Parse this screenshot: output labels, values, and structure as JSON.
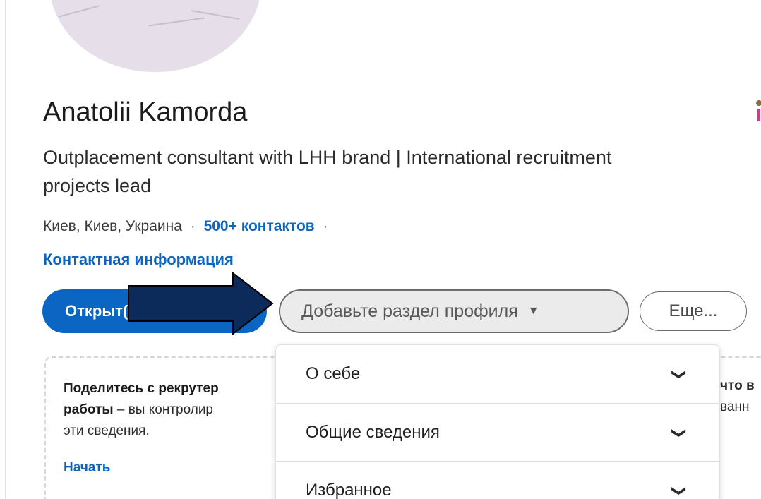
{
  "profile": {
    "name": "Anatolii Kamorda",
    "headline": "Outplacement consultant with LHH brand | International recruitment projects lead",
    "location": "Киев, Киев, Украина",
    "separator": "·",
    "contacts_link": "500+ контактов",
    "contact_info_link": "Контактная информация"
  },
  "actions": {
    "primary_button": "Открыт(-а) для",
    "add_section_button": "Добавьте раздел профиля",
    "add_section_caret": "▼",
    "more_button": "Еще..."
  },
  "open_to_work_card": {
    "text_bold_1": "Поделитесь с рекрутер",
    "text_bold_2": "работы",
    "text_rest_2": " – вы контролир",
    "text_line_3": "эти сведения.",
    "text_right_1": "что в",
    "text_right_2": "ванн",
    "start_link": "Начать"
  },
  "dropdown": {
    "items": [
      {
        "label": "О себе",
        "chevron": "❯"
      },
      {
        "label": "Общие сведения",
        "chevron": "❯"
      },
      {
        "label": "Избранное",
        "chevron": "❯"
      }
    ]
  },
  "colors": {
    "brand_blue": "#0a66c2",
    "arrow_fill": "#0c2a5a"
  },
  "icons": {
    "caret": "caret-down-icon",
    "chevron": "chevron-down-icon",
    "annotation_arrow": "arrow-right-icon"
  }
}
